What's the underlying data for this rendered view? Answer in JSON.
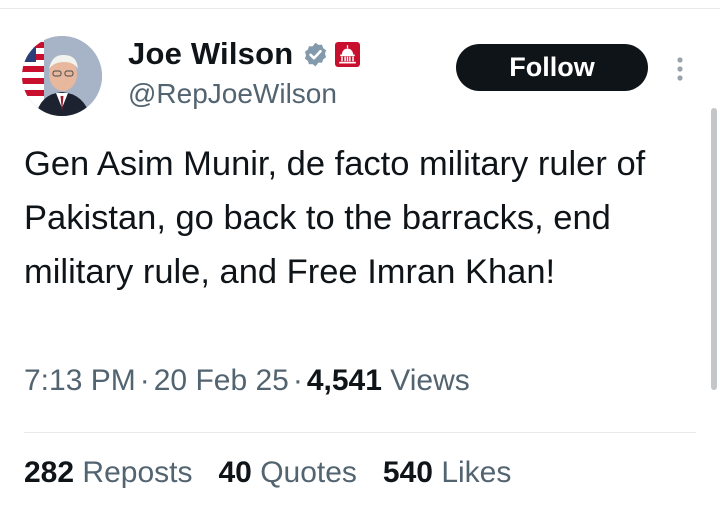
{
  "author": {
    "name": "Joe Wilson",
    "handle": "@RepJoeWilson"
  },
  "follow_label": "Follow",
  "tweet": {
    "text": "Gen Asim Munir, de facto military ruler of Pakistan, go back to the barracks, end military rule, and Free Imran Khan!"
  },
  "meta": {
    "time": "7:13 PM",
    "separator": "·",
    "date": "20 Feb 25",
    "views_count": "4,541",
    "views_label": "Views"
  },
  "stats": {
    "reposts_count": "282",
    "reposts_label": "Reposts",
    "quotes_count": "40",
    "quotes_label": "Quotes",
    "likes_count": "540",
    "likes_label": "Likes"
  },
  "icons": {
    "verified": "verified-badge-icon",
    "gov_badge": "us-capitol-badge-icon",
    "more": "more-vertical-icon"
  },
  "colors": {
    "follow_bg": "#0f1419",
    "secondary_text": "#536471",
    "verified_badge": "#829aab",
    "gov_badge": "#c8102e"
  }
}
